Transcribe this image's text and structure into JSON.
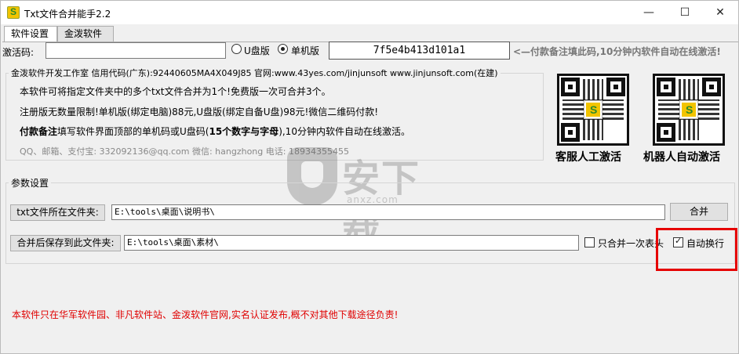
{
  "window": {
    "title": "Txt文件合并能手2.2",
    "minimize_glyph": "—",
    "maximize_glyph": "☐",
    "close_glyph": "✕",
    "icon": "app-logo-icon"
  },
  "tabs": [
    {
      "label": "软件设置",
      "active": true
    },
    {
      "label": "金泼软件",
      "active": false
    }
  ],
  "activation": {
    "label": "激活码:",
    "code_value": "",
    "radio_u_label": "U盘版",
    "radio_single_label": "单机版",
    "selected": "单机版",
    "machine_code": "7f5e4b413d101a1",
    "pay_hint": "<—付款备注填此码,10分钟内软件自动在线激活!"
  },
  "info": {
    "group_title": "金泼软件开发工作室 信用代码(广东):92440605MA4X049J85 官网:www.43yes.com/jinjunsoft  www.jinjunsoft.com(在建)",
    "line1": "本软件可将指定文件夹中的多个txt文件合并为1个!免费版一次可合并3个。",
    "line2": "注册版无数量限制!单机版(绑定电脑)88元,U盘版(绑定自备U盘)98元!微信二维码付款!",
    "line3_bold": "付款备注",
    "line3_rest": "填写软件界面顶部的单机码或U盘码(",
    "line3_bold2": "15个数字与字母",
    "line3_end": "),10分钟内软件自动在线激活。",
    "line4": "QQ、邮箱、支付宝: 332092136@qq.com   微信: hangzhong   电话: 18934355455"
  },
  "qr": {
    "caption1": "客服人工激活",
    "caption2": "机器人自动激活"
  },
  "params": {
    "group_title": "参数设置",
    "txt_folder_button": "txt文件所在文件夹:",
    "txt_folder_path": "E:\\tools\\桌面\\说明书\\",
    "merge_button": "合并",
    "save_folder_button": "合并后保存到此文件夹:",
    "save_folder_path": "E:\\tools\\桌面\\素材\\",
    "only_header_label": "只合并一次表头",
    "only_header_checked": false,
    "auto_wrap_label": "自动换行",
    "auto_wrap_checked": true
  },
  "notice": "本软件只在华军软件园、非凡软件站、金泼软件官网,实名认证发布,概不对其他下载途径负责!",
  "watermark": {
    "text": "安下载",
    "sub": "anxz.com"
  },
  "colors": {
    "highlight": "#e60000",
    "notice": "#e00000",
    "logo_yellow": "#f2c400",
    "logo_green": "#2c8a2c"
  }
}
